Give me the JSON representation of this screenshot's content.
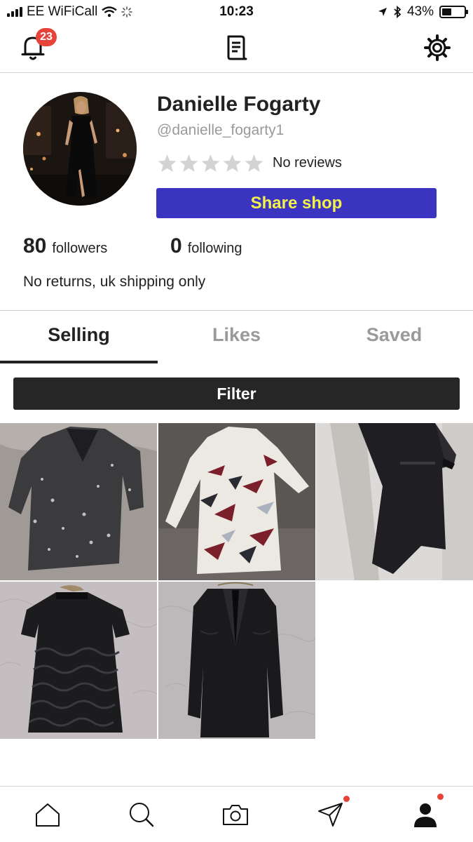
{
  "status_bar": {
    "carrier": "EE WiFiCall",
    "time": "10:23",
    "battery": "43%",
    "battery_level": 0.43
  },
  "top_nav": {
    "notification_count": "23",
    "icons": [
      "bell-icon",
      "receipt-icon",
      "gear-icon"
    ]
  },
  "profile": {
    "name": "Danielle Fogarty",
    "handle": "@danielle_fogarty1",
    "rating_stars": 0,
    "rating_max": 5,
    "reviews_label": "No reviews",
    "share_label": "Share shop",
    "followers_count": "80",
    "followers_label": "followers",
    "following_count": "0",
    "following_label": "following",
    "bio": "No returns, uk shipping only"
  },
  "tabs": [
    {
      "label": "Selling",
      "active": true
    },
    {
      "label": "Likes",
      "active": false
    },
    {
      "label": "Saved",
      "active": false
    }
  ],
  "filter_label": "Filter",
  "listings": [
    {
      "item": "sequin blazer dress"
    },
    {
      "item": "printed long-sleeve dress"
    },
    {
      "item": "black satin dress"
    },
    {
      "item": "black lace dress"
    },
    {
      "item": "black long-sleeve dress"
    }
  ],
  "bottom_nav": {
    "items": [
      "home-icon",
      "search-icon",
      "camera-icon",
      "send-icon",
      "profile-icon"
    ],
    "unread_dots": [
      "send",
      "profile"
    ]
  },
  "colors": {
    "accent_blue": "#3b34c0",
    "share_text_yellow": "#f2f24a",
    "badge_red": "#e8433b",
    "dark_button": "#262626",
    "muted_text": "#9a9a9a"
  }
}
